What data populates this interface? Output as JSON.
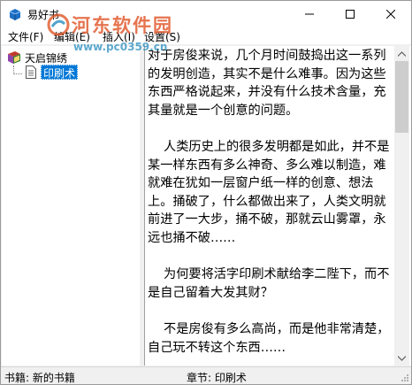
{
  "window": {
    "title": "易好书",
    "controls": {
      "minimize": "minimize-icon",
      "maximize": "maximize-icon",
      "close": "close-icon"
    }
  },
  "menu": [
    {
      "label": "文件(F)"
    },
    {
      "label": "编辑(E)"
    },
    {
      "label": "插入(I)"
    },
    {
      "label": "设置(S)"
    }
  ],
  "watermark": {
    "title": "河东软件园",
    "url": "www.pc0359.cn"
  },
  "tree": {
    "root": {
      "label": "天启锦绣",
      "icon": "book-icon"
    },
    "selected_child": {
      "label": "印刷术",
      "icon": "document-icon"
    }
  },
  "content": {
    "paragraphs": [
      "对于房俊来说，几个月时间鼓捣出这一系列的发明创造，其实不是什么难事。因为这些东西严格说起来，并没有什么技术含量，充其量就是一个创意的问题。",
      "    人类历史上的很多发明都是如此，并不是某一样东西有多么神奇、多么难以制造，难就难在犹如一层窗户纸一样的创意、想法上。捅破了，什么都做出来了，人类文明就前进了一大步，捅不破，那就云山雾罩，永远也捅不破……",
      "    为何要将活字印刷术献给李二陛下，而不是自己留着大发其财？",
      "    不是房俊有多么高尚，而是他非常清楚，自己玩不转这个东西……"
    ]
  },
  "status": {
    "book": "书籍: 新的书籍",
    "chapter": "章节: 印刷术"
  },
  "colors": {
    "selection": "#0078d7",
    "watermark_title": "#e05628",
    "watermark_url": "#288cbe"
  }
}
